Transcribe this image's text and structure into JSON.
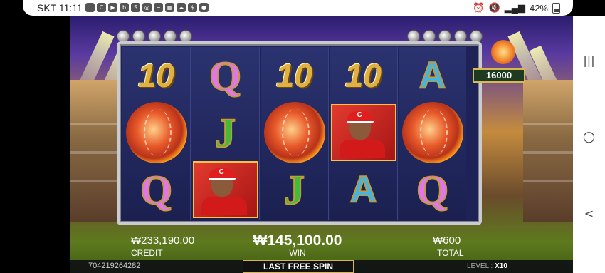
{
  "status_bar": {
    "time": "SKT 11:11",
    "battery": "42%",
    "icons": [
      "chat-icon",
      "c-icon",
      "youtube-icon",
      "b-icon",
      "s-icon",
      "instagram-icon",
      "zigzag-icon",
      "image-icon",
      "cloud-icon",
      "sol-pay-icon",
      "message-icon"
    ]
  },
  "game": {
    "bonus_value": "16000",
    "reels": [
      [
        {
          "type": "num",
          "label": "10"
        },
        {
          "type": "fireball",
          "label": ""
        },
        {
          "type": "q",
          "label": "Q"
        }
      ],
      [
        {
          "type": "q",
          "label": "Q"
        },
        {
          "type": "j",
          "label": "J"
        },
        {
          "type": "player",
          "label": "C"
        }
      ],
      [
        {
          "type": "num",
          "label": "10"
        },
        {
          "type": "fireball",
          "label": ""
        },
        {
          "type": "j",
          "label": "J"
        }
      ],
      [
        {
          "type": "num",
          "label": "10"
        },
        {
          "type": "player",
          "label": "C"
        },
        {
          "type": "a",
          "label": "A"
        }
      ],
      [
        {
          "type": "a",
          "label": "A"
        },
        {
          "type": "fireball",
          "label": ""
        },
        {
          "type": "q",
          "label": "Q"
        }
      ]
    ],
    "credit": {
      "value": "₩233,190.00",
      "label": "CREDIT"
    },
    "win": {
      "value": "₩145,100.00",
      "label": "WIN"
    },
    "total": {
      "value": "₩600",
      "label": "TOTAL"
    },
    "game_id": "704219264282",
    "free_spin_label": "LAST FREE SPIN",
    "level_label": "LEVEL :",
    "level_value": "X10"
  },
  "nav": {
    "recent_glyph": "|||",
    "home_glyph": "○",
    "back_glyph": "<"
  }
}
